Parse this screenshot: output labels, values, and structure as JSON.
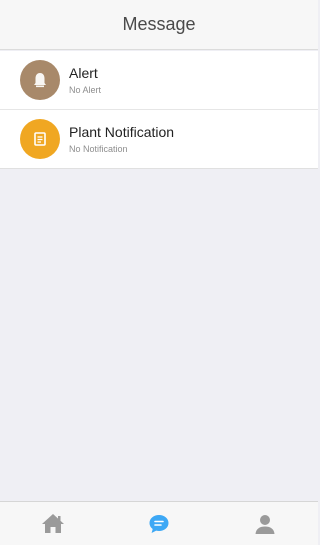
{
  "header": {
    "title": "Message"
  },
  "messages": [
    {
      "title": "Alert",
      "subtitle": "No Alert",
      "icon": "alert-bell-icon",
      "color": "#a8896a"
    },
    {
      "title": "Plant Notification",
      "subtitle": "No Notification",
      "icon": "notification-note-icon",
      "color": "#f0a722"
    }
  ],
  "tabbar": {
    "tabs": [
      {
        "icon": "home-icon",
        "active": false
      },
      {
        "icon": "message-bubble-icon",
        "active": true
      },
      {
        "icon": "user-icon",
        "active": false
      }
    ],
    "active_color": "#3da8f5",
    "inactive_color": "#9a9a9a"
  }
}
